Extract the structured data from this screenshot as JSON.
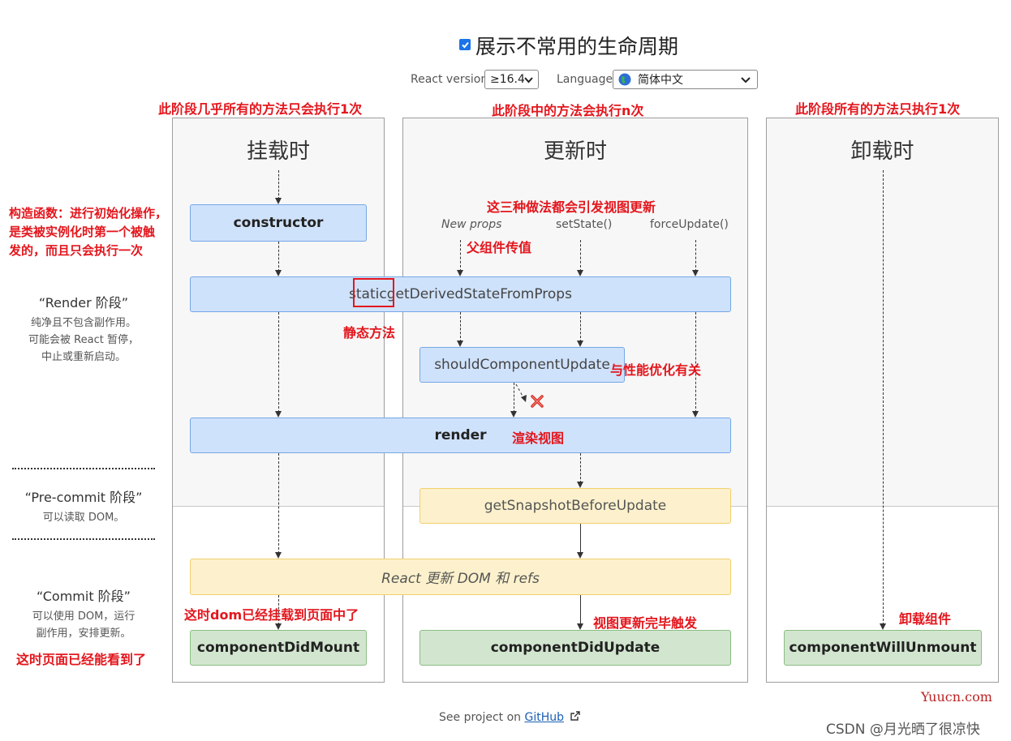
{
  "header": {
    "checkbox_label": "展示不常用的生命周期",
    "checkbox_checked": true,
    "version_label": "React version",
    "version_value": "≥16.4",
    "language_label": "Language",
    "language_value": "简体中文"
  },
  "columns": {
    "mount": {
      "title": "挂载时"
    },
    "update": {
      "title": "更新时"
    },
    "unmount": {
      "title": "卸载时"
    }
  },
  "phases": {
    "render": {
      "title": "“Render 阶段”",
      "desc": [
        "纯净且不包含副作用。",
        "可能会被 React 暂停，",
        "中止或重新启动。"
      ]
    },
    "precommit": {
      "title": "“Pre-commit 阶段”",
      "desc": [
        "可以读取 DOM。"
      ]
    },
    "commit": {
      "title": "“Commit 阶段”",
      "desc": [
        "可以使用 DOM，运行",
        "副作用，安排更新。"
      ]
    }
  },
  "triggers": {
    "new_props": "New props",
    "set_state": "setState()",
    "force_update": "forceUpdate()"
  },
  "methods": {
    "constructor": "constructor",
    "static_keyword": "static",
    "gdsfp": " getDerivedStateFromProps",
    "scu": "shouldComponentUpdate",
    "render": "render",
    "gsbu": "getSnapshotBeforeUpdate",
    "react_update_dom": "React 更新 DOM 和 refs",
    "cdm": "componentDidMount",
    "cdu": "componentDidUpdate",
    "cwu": "componentWillUnmount"
  },
  "annotations": {
    "mount_once": "此阶段几乎所有的方法只会执行1次",
    "update_n": "此阶段中的方法会执行n次",
    "unmount_once": "此阶段所有的方法只执行1次",
    "constructor_note": [
      "构造函数：进行初始化操作，",
      "是类被实例化时第一个被触",
      "发的，而且只会执行一次"
    ],
    "three_ways": "这三种做法都会引发视图更新",
    "parent_props": "父组件传值",
    "static_method": "静态方法",
    "perf": "与性能优化有关",
    "render_view": "渲染视图",
    "dom_mounted": "这时dom已经挂载到页面中了",
    "page_visible": "这时页面已经能看到了",
    "view_updated": "视图更新完毕触发",
    "unmount_comp": "卸载组件"
  },
  "footer": {
    "see_project": "See project on ",
    "github": "GitHub"
  },
  "watermark": {
    "site": "Yuucn.com",
    "csdn": "CSDN @月光晒了很凉快"
  }
}
